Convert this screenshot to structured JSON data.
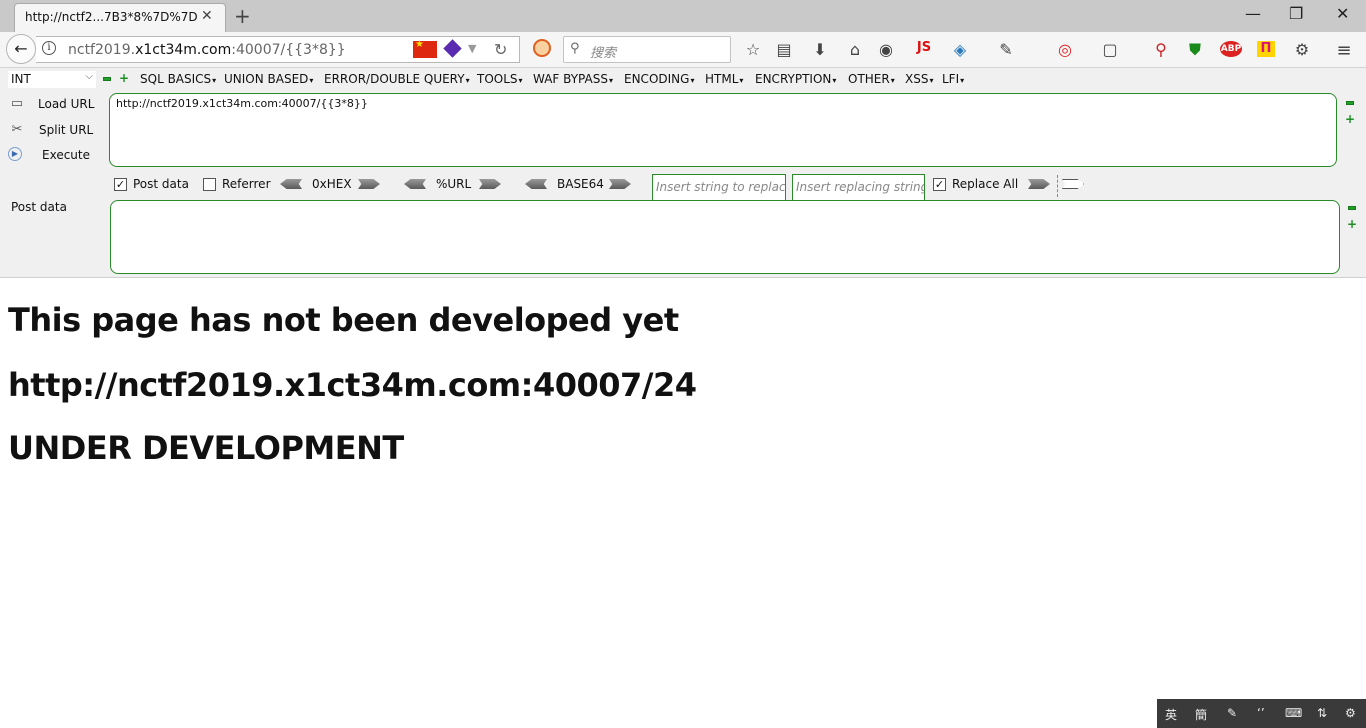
{
  "browser": {
    "tab_title": "http://nctf2...7B3*8%7D%7D",
    "tab_close": "✕",
    "new_tab": "+",
    "window_minimize": "—",
    "window_restore": "❐",
    "window_close": "✕",
    "url_prefix": "nctf2019.",
    "url_host": "x1ct34m.com",
    "url_rest": ":40007/{{3*8}}",
    "search_placeholder": "搜索",
    "toolbar_icons": [
      "star-icon",
      "reading-list-icon",
      "download-icon",
      "home-icon",
      "globe-icon",
      "js-icon",
      "translate-icon",
      "palette-icon",
      "screenshot-icon",
      "devices-icon",
      "zoom-icon",
      "shield-icon",
      "abp-icon",
      "pi-icon",
      "settings-gear-icon",
      "menu-icon"
    ],
    "js_label": "JS",
    "abp_label": "ABP",
    "pi_label": "П"
  },
  "hackbar": {
    "type_select": "INT",
    "menus": [
      "SQL BASICS",
      "UNION BASED",
      "ERROR/DOUBLE QUERY",
      "TOOLS",
      "WAF BYPASS",
      "ENCODING",
      "HTML",
      "ENCRYPTION",
      "OTHER",
      "XSS",
      "LFI"
    ],
    "load_url": "Load URL",
    "split_url": "Split URL",
    "execute": "Execute",
    "url_value": "http://nctf2019.x1ct34m.com:40007/{{3*8}}",
    "post_data_checkbox": "Post data",
    "post_data_checked": true,
    "referrer_checkbox": "Referrer",
    "referrer_checked": false,
    "hex_label": "0xHEX",
    "url_enc_label": "%URL",
    "base64_label": "BASE64",
    "replace_string_placeholder": "Insert string to replace",
    "replacing_string_placeholder": "Insert replacing string",
    "replace_all_label": "Replace All",
    "replace_all_checked": true,
    "post_data_label": "Post data",
    "post_data_value": ""
  },
  "page": {
    "heading1": "This page has not been developed yet",
    "heading2": "http://nctf2019.x1ct34m.com:40007/24",
    "heading3": "UNDER DEVELOPMENT"
  },
  "ime": {
    "lang": "英",
    "mode": "簡"
  }
}
